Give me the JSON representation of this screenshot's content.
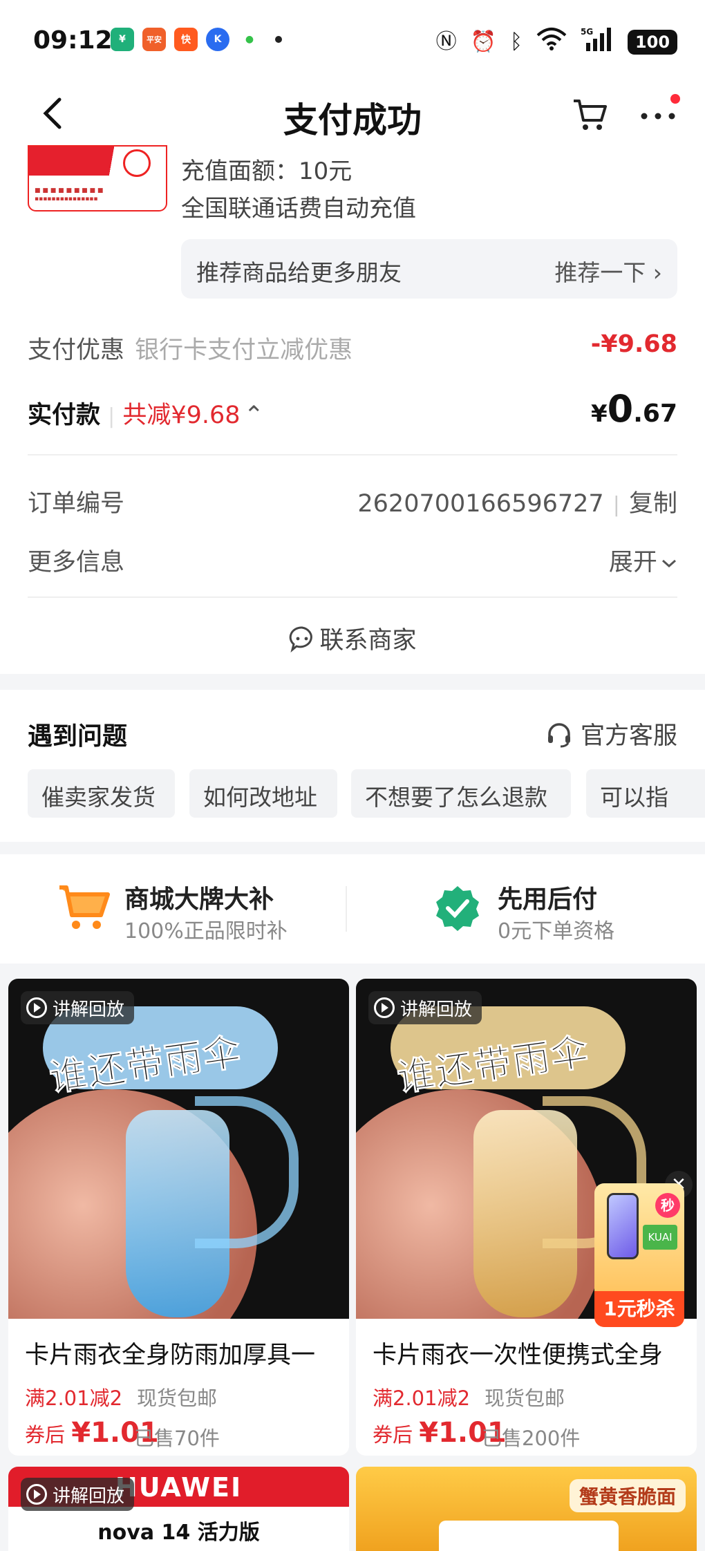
{
  "status_bar": {
    "time": "09:12",
    "apps": [
      {
        "name": "wallet-app-icon",
        "text": "¥",
        "color": "#20b07a"
      },
      {
        "name": "pingan-bank-icon",
        "text": "平安",
        "color": "#f0602a"
      },
      {
        "name": "kuaishou-icon",
        "text": "快",
        "color": "#ff5a1f"
      },
      {
        "name": "k-app-icon",
        "text": "K",
        "color": "#2a6cf0"
      },
      {
        "name": "wechat-like-icon",
        "text": "●",
        "color": "#35c24a"
      }
    ],
    "battery": "100",
    "network": "5G"
  },
  "nav": {
    "title": "支付成功"
  },
  "order": {
    "recharge_amount": "充值面额：10元",
    "product_name": "全国联通话费自动充值",
    "recommend_label": "推荐商品给更多朋友",
    "recommend_action": "推荐一下 ›",
    "discount_label": "支付优惠",
    "discount_desc": "银行卡支付立减优惠",
    "discount_value": "-¥9.68",
    "paid_label": "实付款",
    "total_saved": "共减¥9.68",
    "paid_currency": "¥",
    "paid_int": "0",
    "paid_dec": ".67",
    "order_no_label": "订单编号",
    "order_no": "2620700166596727",
    "copy_label": "复制",
    "more_info_label": "更多信息",
    "expand_label": "展开",
    "contact_label": "联系商家"
  },
  "problem": {
    "title": "遇到问题",
    "service_label": "官方客服",
    "chips": [
      "催卖家发货",
      "如何改地址",
      "不想要了怎么退款",
      "可以指"
    ]
  },
  "promo": [
    {
      "title": "商城大牌大补",
      "sub": "100%正品限时补"
    },
    {
      "title": "先用后付",
      "sub": "0元下单资格"
    }
  ],
  "products": [
    {
      "badge": "讲解回放",
      "image_text": "谁还带雨伞",
      "title": "卡片雨衣全身防雨加厚具一",
      "promo": "满2.01减2",
      "shipping": "现货包邮",
      "price_prefix": "券后",
      "price": "¥1.01",
      "sold": "已售70件",
      "accent": "#6fc8ff"
    },
    {
      "badge": "讲解回放",
      "image_text": "谁还带雨伞",
      "title": "卡片雨衣一次性便携式全身",
      "promo": "满2.01减2",
      "shipping": "现货包邮",
      "price_prefix": "券后",
      "price": "¥1.01",
      "sold": "已售200件",
      "accent": "#e9c46a"
    }
  ],
  "floating_sale": {
    "label": "1元秒杀",
    "badge": "秒",
    "tag": "KUAI"
  },
  "bottom_cards": [
    {
      "badge": "讲解回放",
      "brand": "HUAWEI",
      "model": "nova 14 活力版"
    },
    {
      "tag": "蟹黄香脆面"
    }
  ],
  "colors": {
    "accent_red": "#e2292f",
    "link_gray": "#aaaaaa",
    "check_green": "#22b07a",
    "cart_orange": "#ff8a1a"
  }
}
